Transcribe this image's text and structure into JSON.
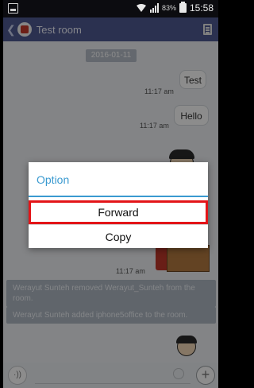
{
  "status_bar": {
    "battery_percent": "83%",
    "time": "15:58"
  },
  "app_bar": {
    "title": "Test room"
  },
  "chat": {
    "date": "2016-01-11",
    "messages": [
      {
        "text": "Test",
        "time": "11:17 am"
      },
      {
        "text": "Hello",
        "time": "11:17 am"
      }
    ],
    "sticker_time": "11:17 am",
    "notices": [
      "Werayut Sunteh removed Werayut_Sunteh from the room.",
      "Werayut Sunteh added iphone5office to the room."
    ]
  },
  "input_bar": {
    "voice_label": "·))",
    "placeholder": "",
    "add_label": "+"
  },
  "dialog": {
    "title": "Option",
    "options": [
      "Forward",
      "Copy"
    ]
  },
  "colors": {
    "app_bar": "#4f5a93",
    "accent": "#3a9ad0",
    "highlight": "#e31418"
  }
}
